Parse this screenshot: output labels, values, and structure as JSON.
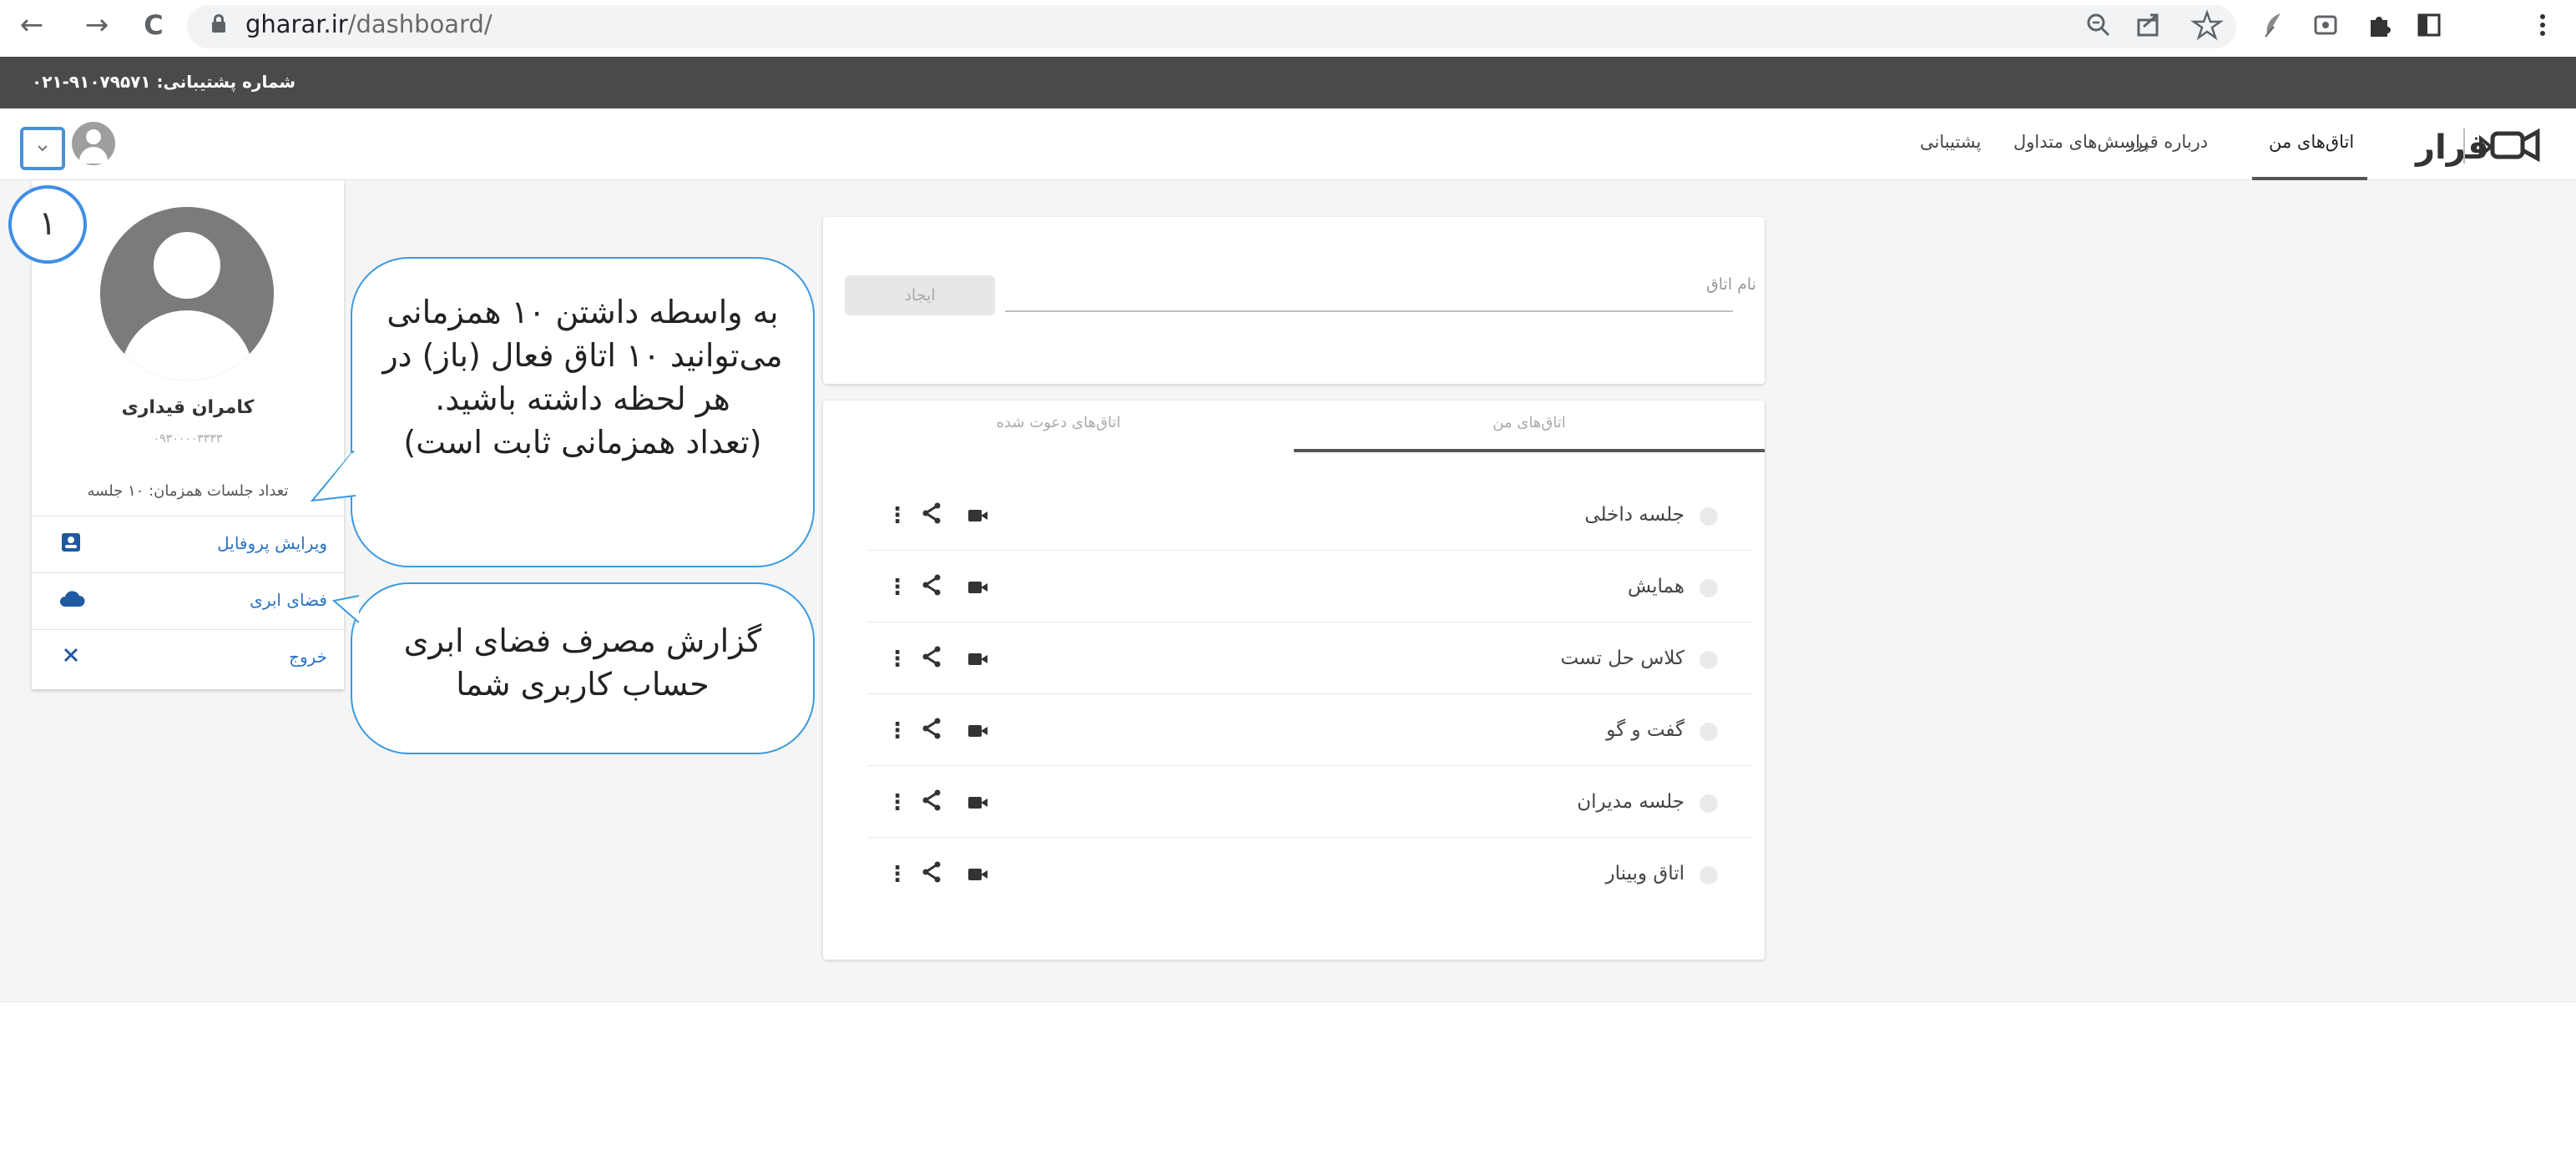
{
  "browser": {
    "url_host": "gharar.ir",
    "url_path": "/dashboard/",
    "nav": {
      "back": "←",
      "forward": "→",
      "reload": "C"
    },
    "icons": [
      "zoom-icon",
      "share-icon",
      "bookmark-star-icon",
      "feather-extension-icon",
      "screen-record-icon",
      "puzzle-extensions-icon",
      "side-panel-icon",
      "kebab-menu-icon"
    ]
  },
  "topbar": {
    "support_phone": "۰۲۱-۹۱۰۷۹۵۷۱ :شماره پشتیبانی"
  },
  "header": {
    "nav": {
      "my_rooms": "اتاق‌های من",
      "about": "درباره قرار",
      "faq": "پرسش‌های متداول",
      "support": "پشتیبانی"
    },
    "active_nav": "my_rooms",
    "brand": "قرار"
  },
  "profile": {
    "name": "کامران قیداری",
    "phone": "۰۹۳۰۰۰۰۳۳۳۳",
    "sessions_count": "تعداد جلسات همزمان: ۱۰ جلسه",
    "menu": {
      "edit_profile": "ویرایش پروفایل",
      "cloud_space": "فضای ابری",
      "logout": "خروج"
    }
  },
  "step_marker": "۱",
  "callouts": {
    "concurrency": "به واسطه داشتن ۱۰ همزمانی می‌توانید ۱۰ اتاق فعال (باز) در هر لحظه داشته باشید.",
    "concurrency_note": "(تعداد همزمانی ثابت است)",
    "cloud": "گزارش مصرف فضای ابری حساب کاربری شما"
  },
  "create_room": {
    "label": "نام اتاق",
    "button": "ایجاد"
  },
  "tabs": {
    "my_rooms": "اتاق‌های من",
    "invited_rooms": "اتاق‌های دعوت شده",
    "active": "my_rooms"
  },
  "rooms": [
    {
      "name": "جلسه داخلی"
    },
    {
      "name": "همایش"
    },
    {
      "name": "کلاس حل تست"
    },
    {
      "name": "گفت و گو"
    },
    {
      "name": "جلسه مدیران"
    },
    {
      "name": "اتاق وبینار"
    }
  ],
  "row_actions": {
    "more": "⋮",
    "share": "<"
  },
  "colors": {
    "topbar": "#4a4a4a",
    "link_blue": "#2a72c2",
    "callout_border": "#3b9ae1",
    "marker_blue": "#3f8ee6"
  }
}
